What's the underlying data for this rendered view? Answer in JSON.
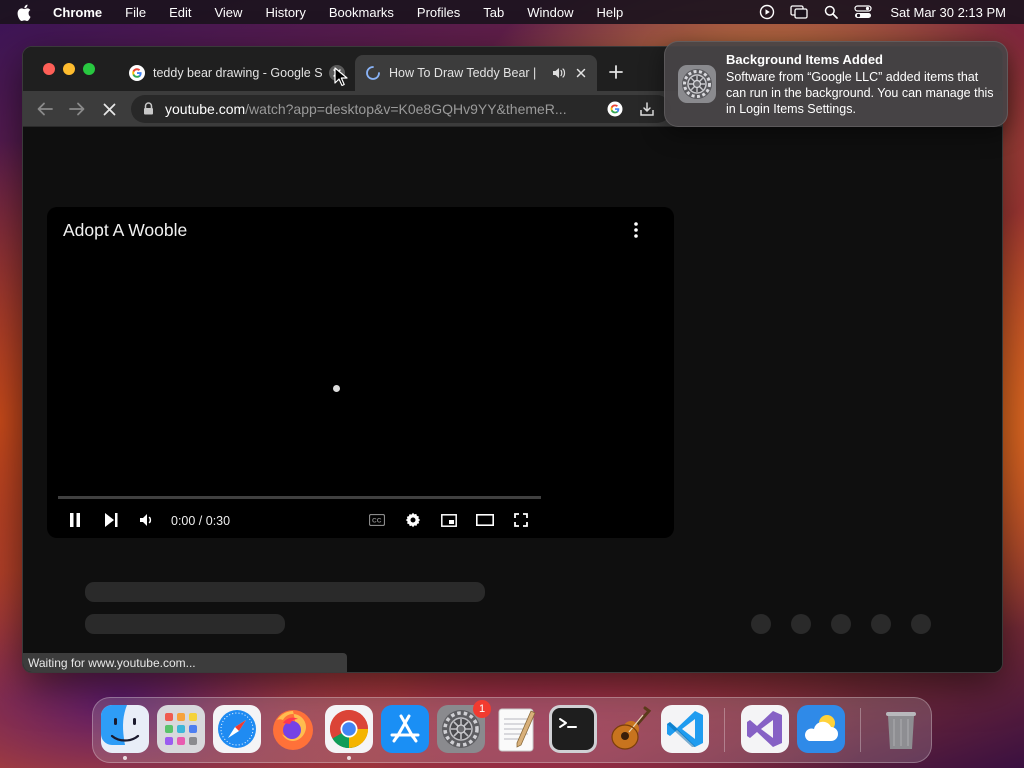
{
  "menubar": {
    "app_name": "Chrome",
    "items": [
      "File",
      "Edit",
      "View",
      "History",
      "Bookmarks",
      "Profiles",
      "Tab",
      "Window",
      "Help"
    ],
    "clock": "Sat Mar 30  2:13 PM",
    "status_icons": [
      "screen-record-icon",
      "screen-mirroring-icon",
      "spotlight-search-icon",
      "control-center-icon"
    ]
  },
  "browser": {
    "tabs": [
      {
        "title": "teddy bear drawing - Google S",
        "favicon": "google-icon",
        "state": "inactive"
      },
      {
        "title": "How To Draw Teddy Bear |",
        "favicon": "loading-spinner-icon",
        "state": "active",
        "audio": "speaker-icon"
      }
    ],
    "url_host": "youtube.com",
    "url_path": "/watch?app=desktop&v=K0e8GQHv9YY&themeR...",
    "status_text": "Waiting for www.youtube.com..."
  },
  "video": {
    "title": "Adopt A Wooble",
    "time": "0:00 / 0:30",
    "progress": 0
  },
  "notification": {
    "title": "Background Items Added",
    "body": "Software from “Google LLC” added items that can run in the background. You can manage this in Login Items Settings.",
    "icon": "system-settings-gear-icon"
  },
  "dock": {
    "apps": [
      "Finder",
      "Launchpad",
      "Safari",
      "Firefox",
      "Google Chrome",
      "App Store",
      "System Settings",
      "TextEdit",
      "Terminal",
      "GarageBand",
      "Visual Studio Code",
      "Visual Studio",
      "Weather",
      "Trash"
    ],
    "system_settings_badge": "1"
  },
  "colors": {
    "accent_blue": "#1a73e8",
    "traffic_red": "#fe5f57",
    "traffic_yellow": "#febc2e",
    "traffic_green": "#28c840",
    "badge_red": "#f23b30"
  }
}
